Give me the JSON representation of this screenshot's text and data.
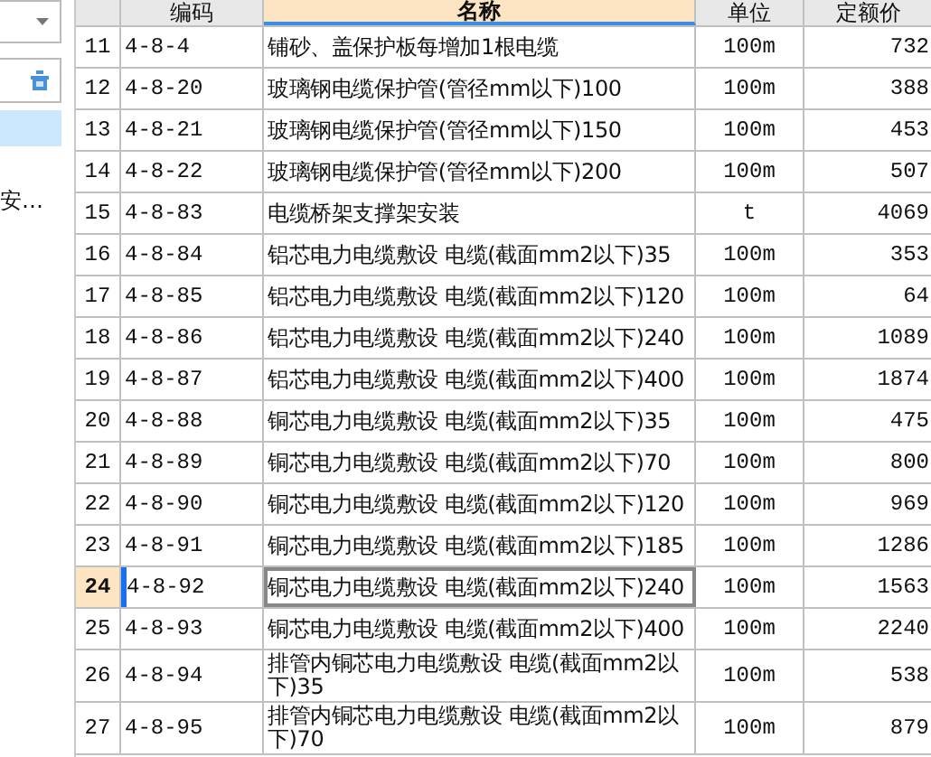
{
  "sidebar": {
    "items": [
      {
        "selected": true
      },
      {
        "label": "安…",
        "selected": false
      }
    ]
  },
  "table": {
    "columns": [
      {
        "label": "编码",
        "selected": false
      },
      {
        "label": "名称",
        "selected": true
      },
      {
        "label": "单位",
        "selected": false
      },
      {
        "label": "定额价",
        "selected": false
      }
    ],
    "rows": [
      {
        "index": "11",
        "code": "4-8-4",
        "name": "铺砂、盖保护板每增加1根电缆",
        "unit": "100m",
        "price": "732",
        "selected": false
      },
      {
        "index": "12",
        "code": "4-8-20",
        "name": "玻璃钢电缆保护管(管径mm以下)100",
        "unit": "100m",
        "price": "388",
        "selected": false
      },
      {
        "index": "13",
        "code": "4-8-21",
        "name": "玻璃钢电缆保护管(管径mm以下)150",
        "unit": "100m",
        "price": "453",
        "selected": false
      },
      {
        "index": "14",
        "code": "4-8-22",
        "name": "玻璃钢电缆保护管(管径mm以下)200",
        "unit": "100m",
        "price": "507",
        "selected": false
      },
      {
        "index": "15",
        "code": "4-8-83",
        "name": "电缆桥架支撑架安装",
        "unit": "t",
        "price": "4069",
        "selected": false
      },
      {
        "index": "16",
        "code": "4-8-84",
        "name": "铝芯电力电缆敷设 电缆(截面mm2以下)35",
        "unit": "100m",
        "price": "353",
        "selected": false
      },
      {
        "index": "17",
        "code": "4-8-85",
        "name": "铝芯电力电缆敷设 电缆(截面mm2以下)120",
        "unit": "100m",
        "price": "64",
        "selected": false
      },
      {
        "index": "18",
        "code": "4-8-86",
        "name": "铝芯电力电缆敷设 电缆(截面mm2以下)240",
        "unit": "100m",
        "price": "1089",
        "selected": false
      },
      {
        "index": "19",
        "code": "4-8-87",
        "name": "铝芯电力电缆敷设 电缆(截面mm2以下)400",
        "unit": "100m",
        "price": "1874",
        "selected": false
      },
      {
        "index": "20",
        "code": "4-8-88",
        "name": "铜芯电力电缆敷设 电缆(截面mm2以下)35",
        "unit": "100m",
        "price": "475",
        "selected": false
      },
      {
        "index": "21",
        "code": "4-8-89",
        "name": "铜芯电力电缆敷设 电缆(截面mm2以下)70",
        "unit": "100m",
        "price": "800",
        "selected": false
      },
      {
        "index": "22",
        "code": "4-8-90",
        "name": "铜芯电力电缆敷设 电缆(截面mm2以下)120",
        "unit": "100m",
        "price": "969",
        "selected": false
      },
      {
        "index": "23",
        "code": "4-8-91",
        "name": "铜芯电力电缆敷设 电缆(截面mm2以下)185",
        "unit": "100m",
        "price": "1286",
        "selected": false
      },
      {
        "index": "24",
        "code": "4-8-92",
        "name": "铜芯电力电缆敷设 电缆(截面mm2以下)240",
        "unit": "100m",
        "price": "1563",
        "selected": true
      },
      {
        "index": "25",
        "code": "4-8-93",
        "name": "铜芯电力电缆敷设 电缆(截面mm2以下)400",
        "unit": "100m",
        "price": "2240",
        "selected": false
      },
      {
        "index": "26",
        "code": "4-8-94",
        "name": "排管内铜芯电力电缆敷设 电缆(截面mm2以下)35",
        "unit": "100m",
        "price": "538",
        "selected": false
      },
      {
        "index": "27",
        "code": "4-8-95",
        "name": "排管内铜芯电力电缆敷设 电缆(截面mm2以下)70",
        "unit": "100m",
        "price": "879",
        "selected": false
      }
    ]
  }
}
